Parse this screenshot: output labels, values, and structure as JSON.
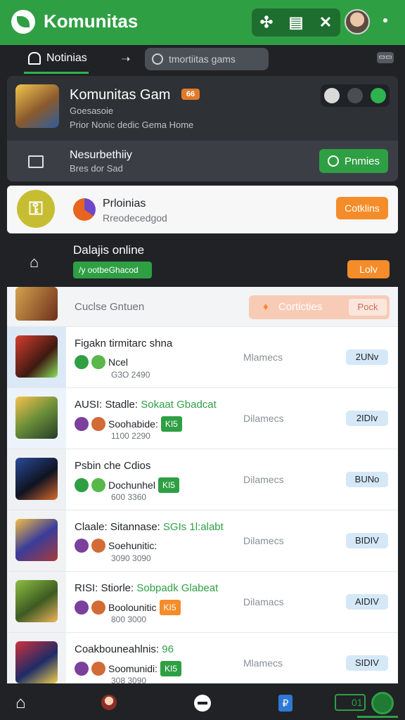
{
  "app": {
    "title": "Komunitas"
  },
  "tabs": {
    "notifications": "Notinias",
    "arrow": "➝",
    "search_placeholder": "tmortiitas gams",
    "kbd": "▭▭"
  },
  "game": {
    "title": "Komunitas Gam",
    "badge": "66",
    "sub1": "Goesasoie",
    "sub2": "Prior Nonic dedic Gema Home",
    "security_title": "Nesurbethiiy",
    "security_sub": "Bres dor Sad",
    "promo_button": "Pnmies"
  },
  "promo": {
    "title": "Prloinias",
    "sub": "Rreodecedgod",
    "button": "Cotklins"
  },
  "online": {
    "title": "Dalajis online",
    "pill": "/y ootbeGhacod",
    "button": "Lolv"
  },
  "list": {
    "head_text": "Cuclse Gntuen",
    "head_pill": "Corticties",
    "head_pill_sub": "Pock",
    "rows": [
      {
        "title": "Figakn tirmitarc shna",
        "title_highlight": "",
        "sub": "Ncel",
        "meta": "G3O 2490",
        "status": "Mlamecs",
        "button": "2UNv",
        "thumb": "linear-gradient(135deg,#d53d2f,#3e1a12 60%,#8ce35b)",
        "sidebg": "#dbe9f6",
        "tag_color": "",
        "tag_text": ""
      },
      {
        "title": "AUSI:  Stadle: ",
        "title_highlight": "Sokaat Gbadcat",
        "sub": "Soohabide:",
        "meta": "1100 2290",
        "status": "Dilamecs",
        "button": "2IDIv",
        "thumb": "linear-gradient(145deg,#f5c24d,#6a8e39 50%,#243d26)",
        "sidebg": "#ecf3fb",
        "tag_color": "#2f9f44",
        "tag_text": "KI5"
      },
      {
        "title": "Psbin che Cdios",
        "title_highlight": "",
        "sub": "Dochunhel",
        "meta": "600 3360",
        "status": "Dilamecs",
        "button": "BUNo",
        "thumb": "linear-gradient(145deg,#2a4b9a,#0f1321 55%,#da6a2d)",
        "sidebg": "#eef1f4",
        "tag_color": "#2f9f44",
        "tag_text": "KI5"
      },
      {
        "title": "Claale: Sitannase: ",
        "title_highlight": "SGIs 1l:alabt",
        "sub": "Soehunitic:",
        "meta": "3090 3090",
        "status": "Dilamecs",
        "button": "BIDIV",
        "thumb": "linear-gradient(145deg,#f3be44,#3a3d9a 50%,#a83a3a)",
        "sidebg": "#f0f2f4",
        "tag_color": "",
        "tag_text": ""
      },
      {
        "title": "RISI:  Stiorle: ",
        "title_highlight": "Sobpadk Glabeat",
        "sub": "Boolounitic",
        "meta": "800 3000",
        "status": "Dilamacs",
        "button": "AIDIV",
        "thumb": "linear-gradient(145deg,#8dbf42,#3d5a22 55%,#f0b65a)",
        "sidebg": "#f0f2f4",
        "tag_color": "#f58c2a",
        "tag_text": "KI5"
      },
      {
        "title": "Coakbouneahlnis: ",
        "title_highlight": "96",
        "sub": "Soomunidi:",
        "meta": "308 3090",
        "status": "Mlamecs",
        "button": "SIDIV",
        "thumb": "linear-gradient(145deg,#d1313b,#1e2b67 55%,#f0d04d)",
        "sidebg": "#f0f2f4",
        "tag_color": "#2f9f44",
        "tag_text": "KI5"
      }
    ]
  },
  "nav": {
    "home": "⌂",
    "blue": "₽",
    "green": "01"
  },
  "colors": {
    "accent": "#2f9f44",
    "orange": "#f58c2a",
    "dark": "#202226"
  }
}
